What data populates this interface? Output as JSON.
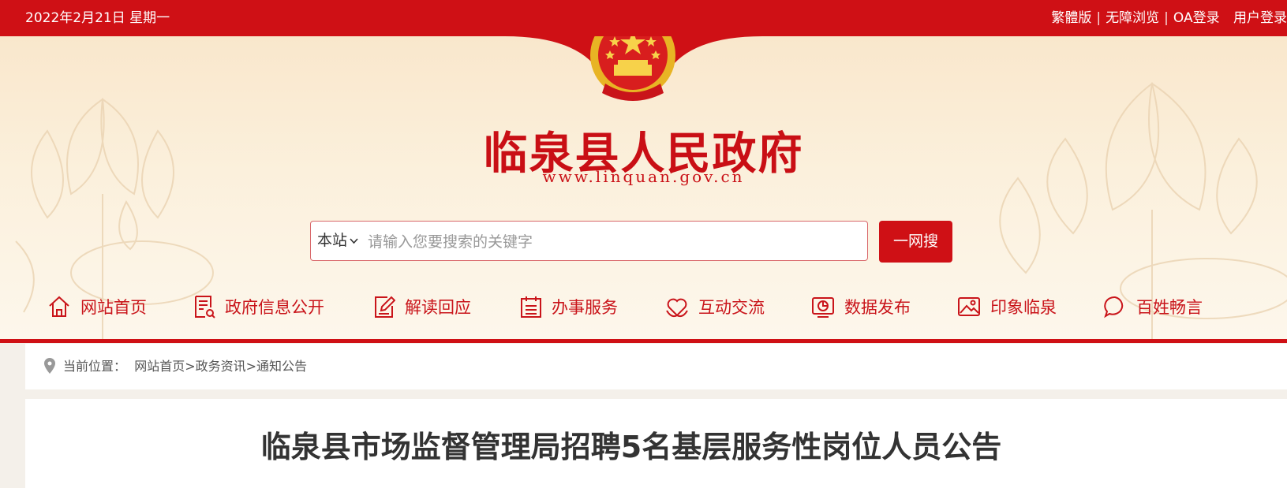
{
  "topbar": {
    "date": "2022年2月21日 星期一",
    "links": [
      "繁體版",
      "无障浏览",
      "OA登录",
      "用户登录"
    ]
  },
  "header": {
    "title": "临泉县人民政府",
    "url": "www.linquan.gov.cn",
    "emblem_icon": "national-emblem"
  },
  "search": {
    "scope": "本站",
    "placeholder": "请输入您要搜索的关键字",
    "value": "",
    "button": "一网搜"
  },
  "nav": [
    {
      "label": "网站首页",
      "icon": "home-icon"
    },
    {
      "label": "政府信息公开",
      "icon": "document-icon"
    },
    {
      "label": "解读回应",
      "icon": "edit-icon"
    },
    {
      "label": "办事服务",
      "icon": "calendar-icon"
    },
    {
      "label": "互动交流",
      "icon": "heart-hands-icon"
    },
    {
      "label": "数据发布",
      "icon": "data-screen-icon"
    },
    {
      "label": "印象临泉",
      "icon": "image-icon"
    },
    {
      "label": "百姓畅言",
      "icon": "chat-icon"
    }
  ],
  "breadcrumb": {
    "prefix": "当前位置：",
    "items": [
      "网站首页",
      "政务资讯",
      "通知公告"
    ],
    "separator": ">"
  },
  "article": {
    "title": "临泉县市场监督管理局招聘5名基层服务性岗位人员公告"
  },
  "colors": {
    "brand_red": "#cf1015",
    "header_bg": "#f9e7cc",
    "text_dark": "#333333"
  }
}
